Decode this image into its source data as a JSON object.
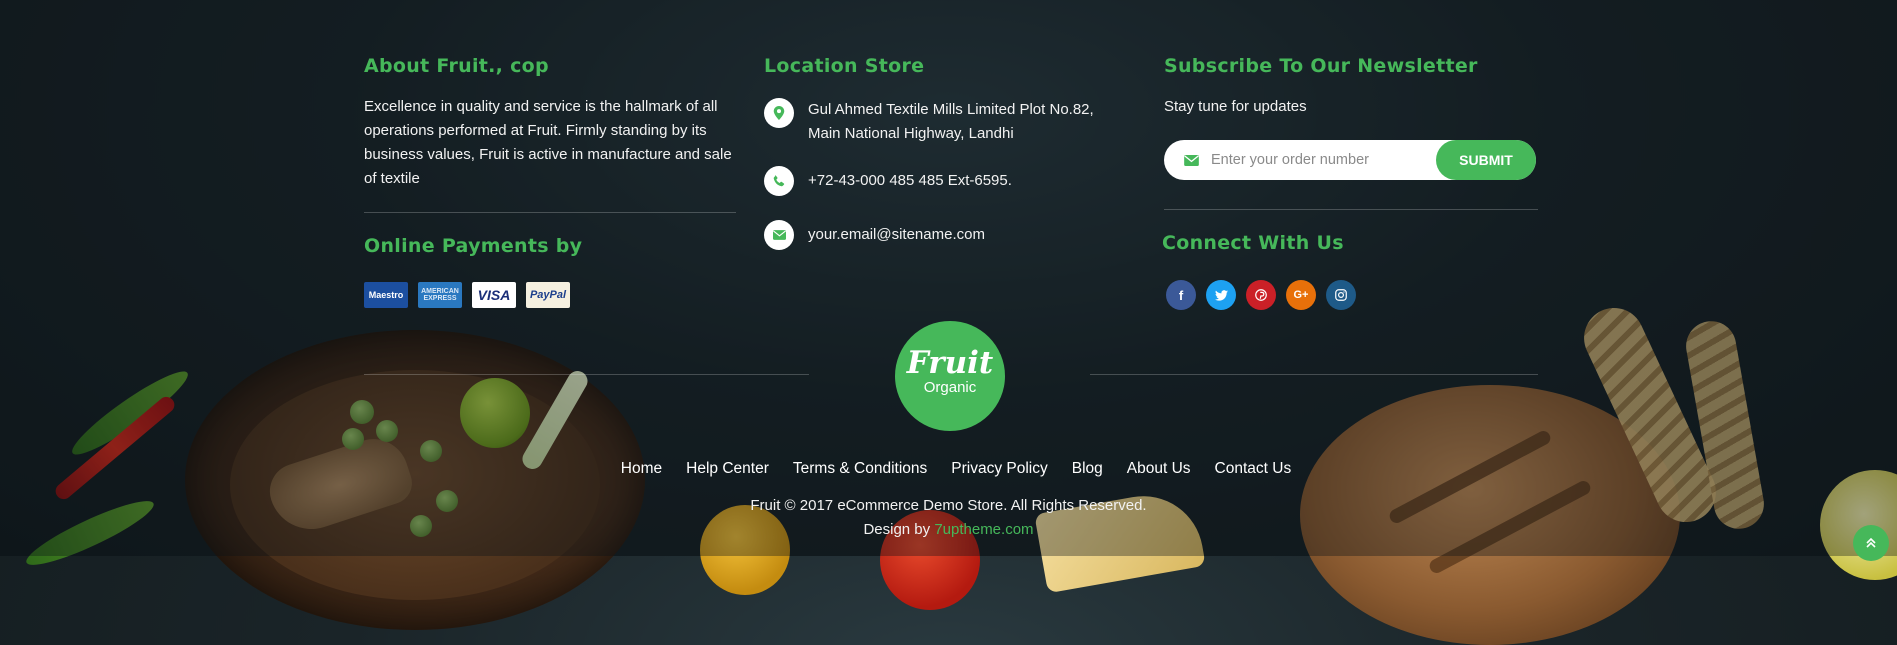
{
  "colors": {
    "accent": "#46b85a",
    "background": "#1a2428",
    "text": "#ffffff"
  },
  "about": {
    "title": "About Fruit., cop",
    "text": "Excellence in quality and service is the hallmark of all operations performed at Fruit. Firmly standing by its business values, Fruit is active in manufacture and sale of textile"
  },
  "payments": {
    "title": "Online Payments by",
    "cards": [
      "Maestro",
      "AMERICAN EXPRESS",
      "VISA",
      "PayPal"
    ]
  },
  "location": {
    "title": "Location Store",
    "address_line1": "Gul Ahmed Textile Mills Limited Plot No.82,",
    "address_line2": "Main National Highway, Landhi",
    "phone": "+72-43-000 485 485 Ext-6595.",
    "email": "your.email@sitename.com",
    "icons": [
      "map-marker-icon",
      "phone-icon",
      "envelope-icon"
    ]
  },
  "newsletter": {
    "title": "Subscribe To Our Newsletter",
    "subtitle": "Stay tune for updates",
    "placeholder": "Enter your order number",
    "value": "",
    "submit_label": "SUBMIT"
  },
  "connect": {
    "title": "Connect With Us",
    "networks": [
      "facebook",
      "twitter",
      "pinterest",
      "google-plus",
      "instagram"
    ]
  },
  "logo": {
    "main": "Fruit",
    "sub": "Organic"
  },
  "nav": {
    "items": [
      "Home",
      "Help Center",
      "Terms & Conditions",
      "Privacy Policy",
      "Blog",
      "About Us",
      "Contact Us"
    ]
  },
  "footer": {
    "copyright": "Fruit © 2017 eCommerce Demo Store. All Rights Reserved.",
    "credit_prefix": "Design by ",
    "credit_link": "7uptheme.com"
  }
}
